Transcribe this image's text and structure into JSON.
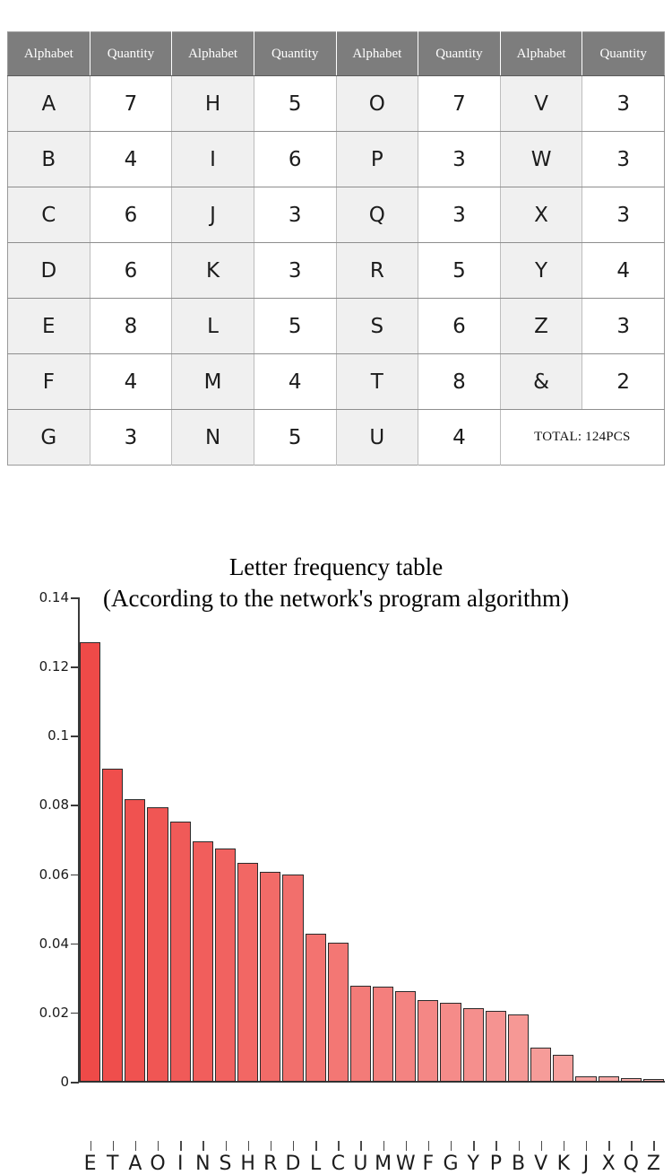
{
  "table": {
    "headers": [
      "Alphabet",
      "Quantity",
      "Alphabet",
      "Quantity",
      "Alphabet",
      "Quantity",
      "Alphabet",
      "Quantity"
    ],
    "rows": [
      [
        "A",
        "7",
        "H",
        "5",
        "O",
        "7",
        "V",
        "3"
      ],
      [
        "B",
        "4",
        "I",
        "6",
        "P",
        "3",
        "W",
        "3"
      ],
      [
        "C",
        "6",
        "J",
        "3",
        "Q",
        "3",
        "X",
        "3"
      ],
      [
        "D",
        "6",
        "K",
        "3",
        "R",
        "5",
        "Y",
        "4"
      ],
      [
        "E",
        "8",
        "L",
        "5",
        "S",
        "6",
        "Z",
        "3"
      ],
      [
        "F",
        "4",
        "M",
        "4",
        "T",
        "8",
        "&",
        "2"
      ],
      [
        "G",
        "3",
        "N",
        "5",
        "U",
        "4"
      ]
    ],
    "total_label": "TOTAL: 124PCS"
  },
  "chart_data": {
    "type": "bar",
    "title": "Letter frequency table",
    "subtitle": "(According to the network's program algorithm)",
    "xlabel": "",
    "ylabel": "",
    "ylim": [
      0,
      0.14
    ],
    "grid": false,
    "legend": null,
    "ytick_labels": [
      "0.14",
      "0.12",
      "0.1",
      "0.08",
      "0.06",
      "0.04",
      "0.02",
      "0"
    ],
    "ytick_values": [
      0.14,
      0.12,
      0.1,
      0.08,
      0.06,
      0.04,
      0.02,
      0
    ],
    "categories": [
      "E",
      "T",
      "A",
      "O",
      "I",
      "N",
      "S",
      "H",
      "R",
      "D",
      "L",
      "C",
      "U",
      "M",
      "W",
      "F",
      "G",
      "Y",
      "P",
      "B",
      "V",
      "K",
      "J",
      "X",
      "Q",
      "Z"
    ],
    "values": [
      0.127,
      0.0905,
      0.0817,
      0.0794,
      0.0753,
      0.0695,
      0.0673,
      0.0633,
      0.0608,
      0.0598,
      0.0428,
      0.0403,
      0.0278,
      0.0276,
      0.0261,
      0.0237,
      0.0227,
      0.0213,
      0.0204,
      0.0195,
      0.0098,
      0.0077,
      0.0015,
      0.0015,
      0.001,
      0.0007
    ],
    "bar_color_start": "#ef4a48",
    "bar_color_end": "#f8b0ad",
    "bar_edge_color": "#2b2b2b",
    "axis_color": "#3a3a3a"
  }
}
